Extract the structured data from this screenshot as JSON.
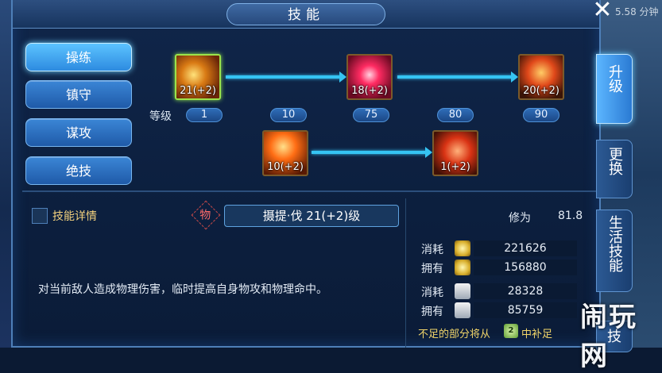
{
  "window": {
    "title": "技能",
    "fps_text": "5.58 分钟"
  },
  "left_tabs": [
    {
      "label": "操练",
      "active": true
    },
    {
      "label": "镇守",
      "active": false
    },
    {
      "label": "谋攻",
      "active": false
    },
    {
      "label": "绝技",
      "active": false
    }
  ],
  "tree": {
    "level_label": "等级",
    "level_thresholds": [
      "1",
      "10",
      "75",
      "80",
      "90"
    ],
    "row1": [
      {
        "level": "21(+2)",
        "icon": "blade-slash-icon",
        "selected": true
      },
      {
        "level": "18(+2)",
        "icon": "crimson-claw-icon",
        "selected": false
      },
      {
        "level": "20(+2)",
        "icon": "flame-strike-icon",
        "selected": false
      }
    ],
    "row2": [
      {
        "level": "10(+2)",
        "icon": "fire-sweep-icon",
        "selected": false
      },
      {
        "level": "1(+2)",
        "icon": "red-fang-icon",
        "selected": false
      }
    ]
  },
  "detail": {
    "checkbox_label": "技能详情",
    "type_badge": "物",
    "skill_name": "摄提·伐 21(+2)级",
    "description": "对当前敌人造成物理伤害，临时提高自身物攻和物理命中。"
  },
  "resources": {
    "xiuwei_label": "修为",
    "xiuwei_value": "81.8",
    "coin_cost_label": "消耗",
    "coin_cost": "221626",
    "coin_own_label": "拥有",
    "coin_own": "156880",
    "scroll_cost_label": "消耗",
    "scroll_cost": "28328",
    "scroll_own_label": "拥有",
    "scroll_own": "85759",
    "insufficient_text": "不足的部分将从",
    "insufficient_icon_text": "2",
    "insufficient_text2": "中补足"
  },
  "right_tabs": [
    "升级",
    "更换",
    "生活技能",
    "技"
  ],
  "watermark": "闹玩网"
}
